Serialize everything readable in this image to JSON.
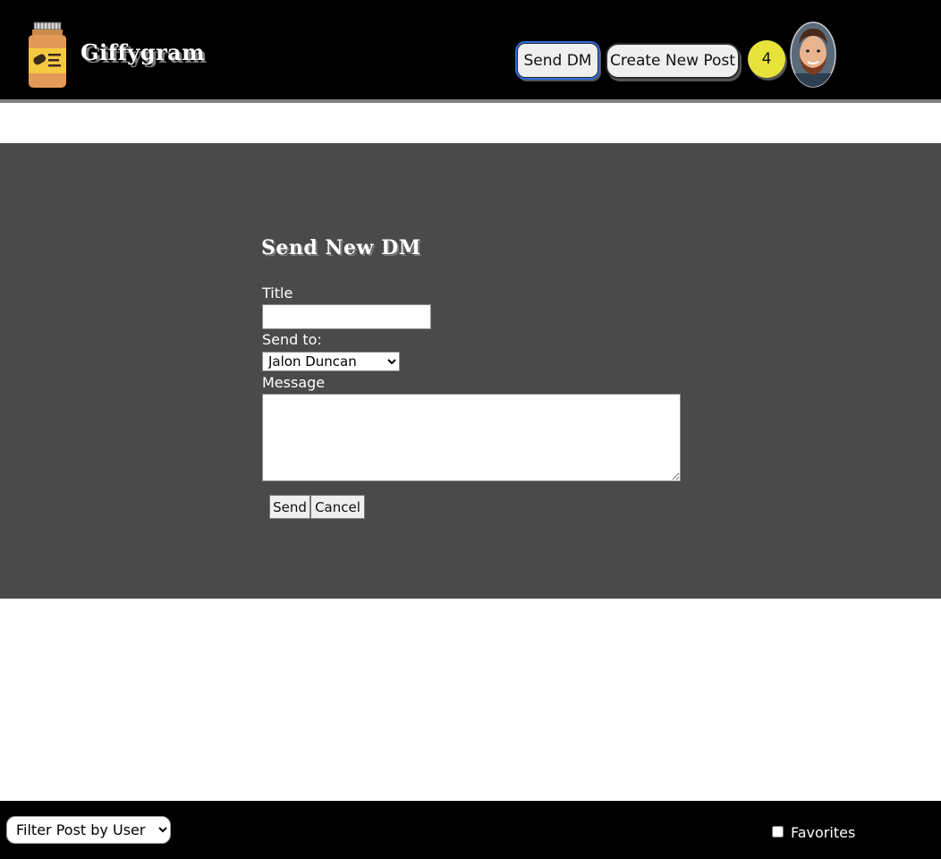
{
  "header": {
    "brand": "Giffygram",
    "send_dm_label": "Send DM",
    "create_post_label": "Create New Post",
    "notification_count": "4",
    "badge_color": "#e8e33a"
  },
  "dm_form": {
    "heading": "Send New DM",
    "title_label": "Title",
    "title_value": "",
    "send_to_label": "Send to:",
    "send_to_selected": "Jalon Duncan",
    "message_label": "Message",
    "message_value": "",
    "send_label": "Send",
    "cancel_label": "Cancel"
  },
  "footer": {
    "filter_selected": "Filter Post by User",
    "favorites_label": "Favorites",
    "favorites_checked": false
  },
  "colors": {
    "header_bg": "#000000",
    "panel_bg": "#4a4a4a",
    "focus_outline": "#2d6cdf"
  },
  "icons": {
    "logo": "peanut-butter-jar-icon",
    "avatar": "bearded-man-avatar"
  }
}
